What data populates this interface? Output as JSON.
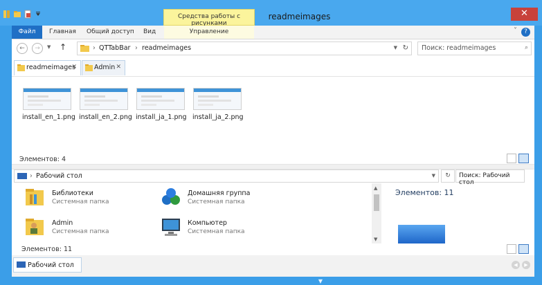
{
  "window": {
    "title": "readmeimages",
    "contextual_group": "Средства работы с рисунками",
    "close_glyph": "✕"
  },
  "ribbon": {
    "tabs": [
      "Файл",
      "Главная",
      "Общий доступ",
      "Вид",
      "Управление"
    ],
    "help_glyph": "?",
    "collapse_glyph": "˅"
  },
  "top_pane": {
    "breadcrumbs": [
      "QTTabBar",
      "readmeimages"
    ],
    "search_placeholder": "Поиск: readmeimages",
    "tabs": [
      {
        "label": "readmeimages",
        "close": "✕"
      },
      {
        "label": "Admin",
        "close": "✕"
      }
    ],
    "files": [
      "install_en_1.png",
      "install_en_2.png",
      "install_ja_1.png",
      "install_ja_2.png"
    ],
    "status": "Элементов: 4"
  },
  "bottom_pane": {
    "breadcrumb": "Рабочий стол",
    "search_placeholder": "Поиск: Рабочий стол",
    "items": [
      {
        "name": "Библиотеки",
        "desc": "Системная папка",
        "icon": "libraries-icon"
      },
      {
        "name": "Домашняя группа",
        "desc": "Системная папка",
        "icon": "homegroup-icon"
      },
      {
        "name": "Admin",
        "desc": "Системная папка",
        "icon": "user-folder-icon"
      },
      {
        "name": "Компьютер",
        "desc": "Системная папка",
        "icon": "computer-icon"
      }
    ],
    "preview_count": "Элементов: 11",
    "status": "Элементов: 11",
    "tab_label": "Рабочий стол"
  },
  "colors": {
    "title_bar": "#49a8ee",
    "file_tab": "#1f6fc5",
    "context_band": "#fbf49c",
    "close": "#c8423b"
  }
}
